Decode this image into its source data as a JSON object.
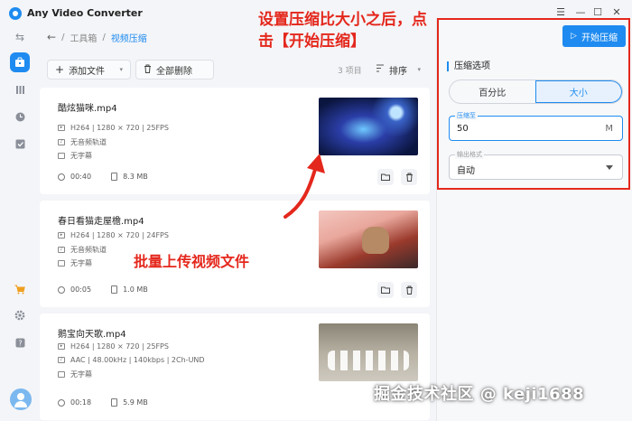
{
  "app": {
    "title": "Any Video Converter"
  },
  "titlebar": {
    "icons": [
      "menu-icon",
      "minimize-icon",
      "maximize-icon",
      "close-icon"
    ],
    "menu": "☰",
    "min": "—",
    "max": "☐",
    "close": "✕"
  },
  "sidebar": {
    "collapse": "⇆",
    "icons": [
      "toolbox-icon",
      "library-icon",
      "history-icon",
      "task-icon",
      "cart-icon",
      "settings-icon",
      "help-icon",
      "avatar"
    ]
  },
  "breadcrumb": {
    "back": "←",
    "sep": "/",
    "root": "工具箱",
    "current": "视频压缩"
  },
  "toolbar": {
    "add_label": "添加文件",
    "delete_all_label": "全部删除",
    "count_label": "3 项目",
    "sort_label": "排序"
  },
  "files": [
    {
      "name": "酷炫猫咪.mp4",
      "video": "H264 | 1280 × 720 | 25FPS",
      "audio": "无音频轨道",
      "subtitle": "无字幕",
      "duration": "00:40",
      "size": "8.3 MB"
    },
    {
      "name": "春日看猫走屋檐.mp4",
      "video": "H264 | 1280 × 720 | 24FPS",
      "audio": "无音频轨道",
      "subtitle": "无字幕",
      "duration": "00:05",
      "size": "1.0 MB"
    },
    {
      "name": "鹅宝向天歌.mp4",
      "video": "H264 | 1280 × 720 | 25FPS",
      "audio": "AAC | 48.00kHz | 140kbps | 2Ch-UND",
      "subtitle": "无字幕",
      "duration": "00:18",
      "size": "5.9 MB"
    }
  ],
  "panel": {
    "start_label": "开始压缩",
    "section_title": "压缩选项",
    "mode_options": [
      "百分比",
      "大小"
    ],
    "mode_selected": "大小",
    "compress_to_label": "压缩至",
    "compress_to_value": "50",
    "compress_to_unit": "M",
    "format_label": "输出格式",
    "format_value": "自动"
  },
  "annotations": {
    "top": "设置压缩比大小之后，点击【开始压缩】",
    "middle": "批量上传视频文件"
  },
  "watermark": "掘金技术社区 @ keji1688",
  "colors": {
    "accent": "#1f8bf0",
    "annotation": "#e4271c"
  }
}
